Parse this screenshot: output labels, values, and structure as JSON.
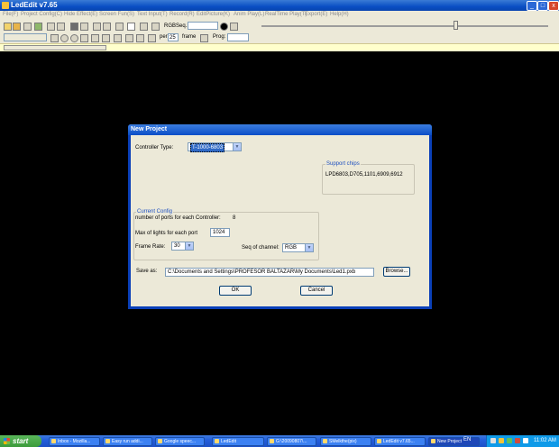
{
  "window": {
    "title": "LedEdit v7.65",
    "minimize": "_",
    "maximize": "□",
    "close": "x"
  },
  "menu": [
    "File(F)",
    "Project Config(C)",
    "Hide Effect(E)",
    "Screen Fun(S)",
    "Text Input(T)",
    "Record(R)",
    "EditPicture(K)",
    "Anim Play(L)",
    "RealTime Play(T)",
    "Export(E)",
    "Help(H)"
  ],
  "toolbar": {
    "rgbseq_label": "RGBSeq.:",
    "per_sec_label": "per sec.",
    "fps_value": "25",
    "frame_label": "frame",
    "prog_label": "Prog:"
  },
  "dialog": {
    "title": "New Project",
    "controller_type_label": "Controller Type:",
    "controller_type_value": "T-1000-6803",
    "support_chips_title": "Support chips",
    "support_chips_value": "LPD6803,D705,1101,6909,6912",
    "current_config_title": "Current Config",
    "ports_label": "number of ports for each Controller:",
    "ports_value": "8",
    "lights_label": "Max of lights for each port",
    "lights_value": "1024",
    "frame_rate_label": "Frame Rate:",
    "frame_rate_value": "30",
    "seq_channel_label": "Seq of channel:",
    "seq_channel_value": "RGB",
    "save_as_label": "Save as:",
    "save_as_value": "C:\\Documents and Settings\\PROFESOR BALTAZAR\\My Documents\\Led1.pxb",
    "browse_label": "Browse...",
    "ok_label": "OK",
    "cancel_label": "Cancel"
  },
  "taskbar": {
    "start_label": "start",
    "tasks": [
      "Inbox - Mozilla...",
      "Easy run addi...",
      "Google speec...",
      "LedEdit",
      "G:\\20090807\\...",
      "SMelkthe(pix)",
      "LedEdit v7.65...",
      "New Project"
    ],
    "language": "EN",
    "clock": "11:02 AM"
  }
}
